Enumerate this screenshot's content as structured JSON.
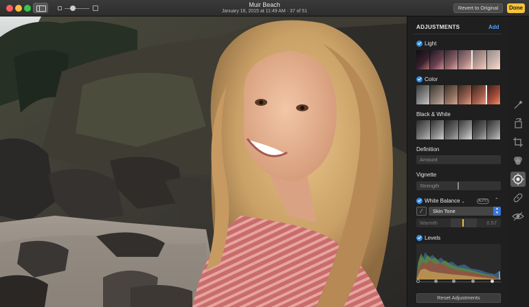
{
  "window": {
    "title": "Muir Beach",
    "subtitle": "January 16, 2015 at 11:49 AM  ·  37 of 51",
    "revert_label": "Revert to Original",
    "done_label": "Done",
    "accent_color": "#f7c43a"
  },
  "adjustments": {
    "heading": "ADJUSTMENTS",
    "add_label": "Add",
    "light": {
      "label": "Light",
      "enabled": true
    },
    "color": {
      "label": "Color",
      "enabled": true
    },
    "black_white": {
      "label": "Black & White"
    },
    "definition": {
      "label": "Definition",
      "field": "Amount"
    },
    "vignette": {
      "label": "Vignette",
      "field": "Strength"
    },
    "white_balance": {
      "label": "White Balance",
      "auto_badge": "AUTO",
      "mode": "Skin Tone",
      "warmth_label": "Warmth",
      "warmth_value": "0.57",
      "warmth_fraction": 0.57
    },
    "levels": {
      "label": "Levels"
    },
    "reset_label": "Reset Adjustments"
  },
  "toolbar": {
    "icons": [
      "magic-wand-icon",
      "rotate-icon",
      "crop-icon",
      "filters-icon",
      "adjust-icon",
      "retouch-icon",
      "red-eye-icon"
    ],
    "active": "adjust-icon"
  }
}
